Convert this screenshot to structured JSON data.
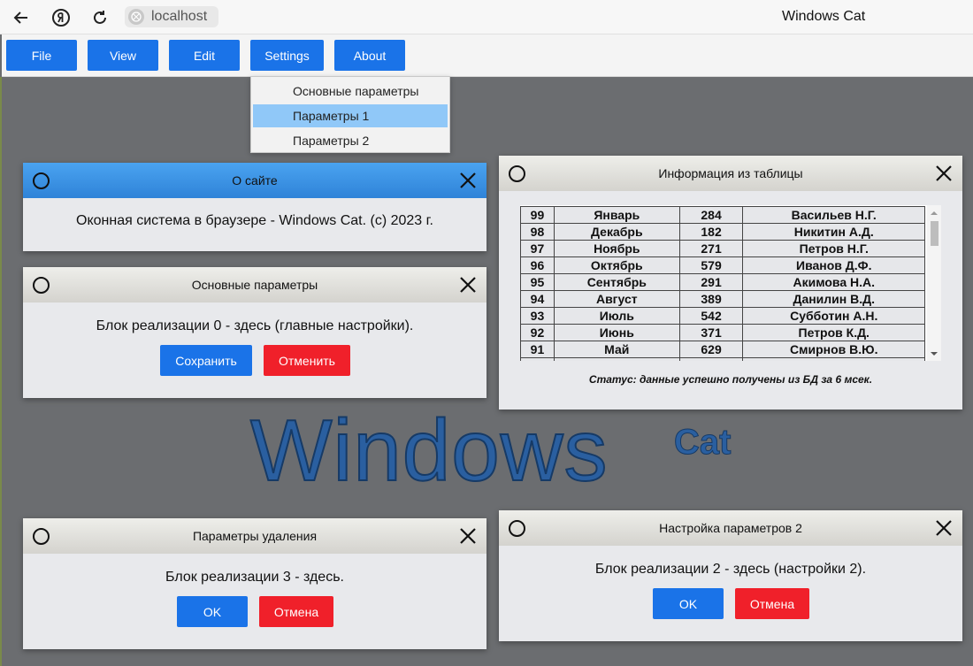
{
  "browser": {
    "url": "localhost",
    "tab_title": "Windows Cat"
  },
  "menu": {
    "items": [
      "File",
      "View",
      "Edit",
      "Settings",
      "About"
    ]
  },
  "dropdown": {
    "items": [
      "Основные параметры",
      "Параметры 1",
      "Параметры 2"
    ],
    "active_index": 1
  },
  "watermark": {
    "main": "Windows",
    "sup": "Cat"
  },
  "windows": {
    "about": {
      "title": "О сайте",
      "text": "Оконная система в браузере - Windows Cat. (c) 2023 г."
    },
    "main_params": {
      "title": "Основные параметры",
      "text": "Блок реализации 0 - здесь (главные настройки).",
      "save": "Сохранить",
      "cancel": "Отменить"
    },
    "table_info": {
      "title": "Информация из таблицы",
      "rows": [
        [
          "99",
          "Январь",
          "284",
          "Васильев Н.Г."
        ],
        [
          "98",
          "Декабрь",
          "182",
          "Никитин А.Д."
        ],
        [
          "97",
          "Ноябрь",
          "271",
          "Петров Н.Г."
        ],
        [
          "96",
          "Октябрь",
          "579",
          "Иванов Д.Ф."
        ],
        [
          "95",
          "Сентябрь",
          "291",
          "Акимова Н.А."
        ],
        [
          "94",
          "Август",
          "389",
          "Данилин В.Д."
        ],
        [
          "93",
          "Июль",
          "542",
          "Субботин А.Н."
        ],
        [
          "92",
          "Июнь",
          "371",
          "Петров К.Д."
        ],
        [
          "91",
          "Май",
          "629",
          "Смирнов В.Ю."
        ]
      ],
      "status": "Статус: данные успешно получены из БД за 6 мсек."
    },
    "delete_params": {
      "title": "Параметры удаления",
      "text": "Блок реализации 3 - здесь.",
      "ok": "OK",
      "cancel": "Отмена"
    },
    "params2": {
      "title": "Настройка параметров 2",
      "text": "Блок реализации 2 - здесь (настройки 2).",
      "ok": "OK",
      "cancel": "Отмена"
    }
  }
}
